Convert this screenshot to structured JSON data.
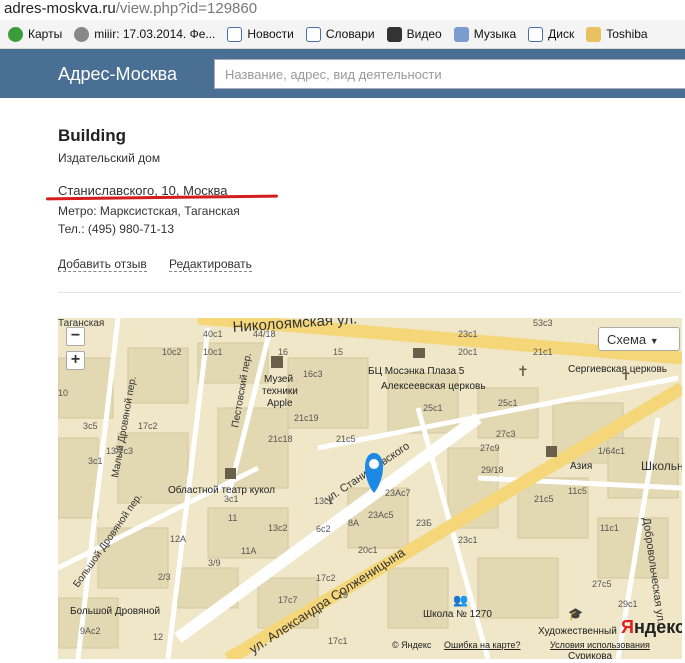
{
  "browser": {
    "url_domain": "adres-moskva.ru",
    "url_path": "/view.php?id=129860",
    "bookmarks": [
      {
        "label": "Карты",
        "icon": "maps-icon",
        "color": "#3a9c3a"
      },
      {
        "label": "miiir: 17.03.2014. Фе...",
        "icon": "miiir-icon",
        "color": "#888888"
      },
      {
        "label": "Новости",
        "icon": "news-icon",
        "color": "#4a6ea8"
      },
      {
        "label": "Словари",
        "icon": "dictionary-icon",
        "color": "#4a6ea8"
      },
      {
        "label": "Видео",
        "icon": "video-icon",
        "color": "#333333"
      },
      {
        "label": "Музыка",
        "icon": "music-icon",
        "color": "#4a6ea8"
      },
      {
        "label": "Диск",
        "icon": "disk-icon",
        "color": "#4a6ea8"
      },
      {
        "label": "Toshiba",
        "icon": "folder-icon",
        "color": "#e8c160"
      }
    ]
  },
  "header": {
    "logo": "Адрес-Москва",
    "search_placeholder": "Название, адрес, вид деятельности"
  },
  "organization": {
    "name": "Building",
    "type": "Издательский дом",
    "address": "Станиславского, 10, Москва",
    "metro": "Метро: Марксистская, Таганская",
    "phone": "Тел.: (495) 980-71-13",
    "add_review": "Добавить отзыв",
    "edit": "Редактировать"
  },
  "map": {
    "zoom_in": "+",
    "zoom_out": "−",
    "scheme_label": "Схема",
    "copyright": "© Яндекс",
    "error_link": "Ошибка на карте?",
    "terms_link": "Условия использования",
    "logo_ya": "Я",
    "logo_rest": "ндекс",
    "streets": [
      "Николоямская ул.",
      "ул. Станиславского",
      "ул. Александра Солженицына",
      "Пестовский пер.",
      "Малый Дровяной пер.",
      "Большой Дровяной пер.",
      "Добровольческая ул.",
      "Школьная",
      "Таганская"
    ],
    "places": [
      "БЦ Мосэнка Плаза 5",
      "Алексеевская церковь",
      "Сергиевская церковь",
      "Музей техники Apple",
      "Областной театр кукол",
      "Азия",
      "Школа № 1270",
      "Художественный",
      "Большой Дровяной",
      "Сурикова"
    ],
    "house_numbers": [
      "40c1",
      "44/18",
      "16",
      "23c1",
      "53c3",
      "10c2",
      "10c1",
      "15",
      "20c1",
      "16c3",
      "21c1",
      "21c19",
      "25c1",
      "21c18",
      "21c5",
      "27c9",
      "29/18",
      "23Ac7",
      "23Ac5",
      "23Б",
      "23c1",
      "17c2",
      "21",
      "11",
      "12A",
      "11A",
      "3/9",
      "17c1",
      "17c2",
      "17c7",
      "19",
      "9Ac2",
      "12",
      "17c2",
      "21c5",
      "3c5",
      "3c1",
      "13c2",
      "13c1",
      "25",
      "27",
      "27c3",
      "1/64c1",
      "11c5",
      "11c1",
      "29c1",
      "27c5",
      "21c5",
      "8A",
      "6c2",
      "20c1",
      "1/64c1",
      "2/3",
      "6c1",
      "1c1",
      "23c3",
      "17c1"
    ]
  }
}
